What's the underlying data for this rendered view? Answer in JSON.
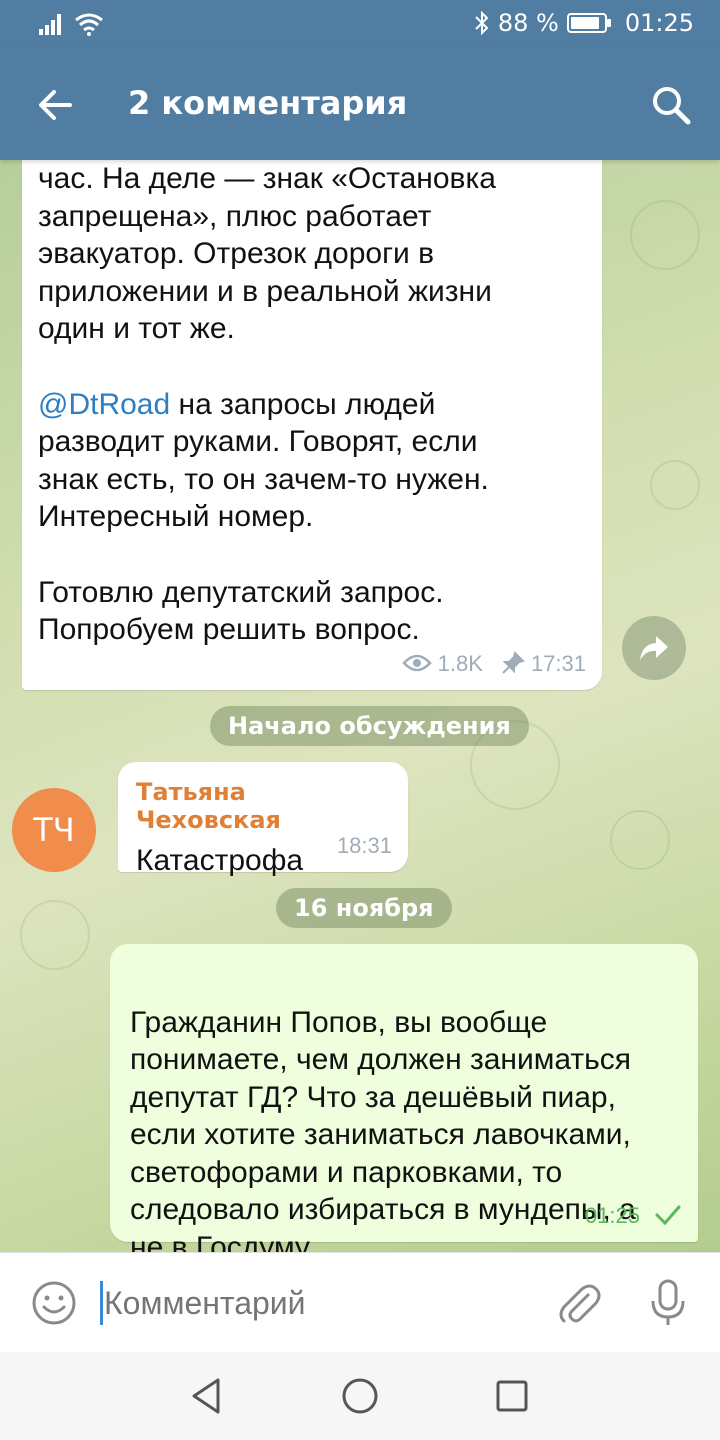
{
  "status_bar": {
    "battery_percent": "88 %",
    "battery_level": 0.88,
    "time": "01:25"
  },
  "header": {
    "title": "2 комментария"
  },
  "post": {
    "lines_1": "час. На деле — знак «Остановка\nзапрещена», плюс работает\nэвакуатор. Отрезок дороги в\nприложении и в реальной жизни\nодин и тот же.",
    "mention": "@DtRoad",
    "lines_2_head": " на запросы людей",
    "lines_2_tail": "разводит руками. Говорят, если\nзнак есть, то он зачем-то нужен.\nИнтересный номер.",
    "lines_3": "Готовлю депутатский запрос.\nПопробуем решить вопрос.",
    "views": "1.8K",
    "time": "17:31"
  },
  "separators": {
    "discussion_start": "Начало обсуждения",
    "date": "16 ноября"
  },
  "incoming_message": {
    "avatar_initials": "ТЧ",
    "author": "Татьяна Чеховская",
    "text": "Катастрофа",
    "time": "18:31"
  },
  "outgoing_message": {
    "text": "Гражданин Попов, вы вообще\nпонимаете, чем должен заниматься\nдепутат ГД? Что за дешёвый пиар,\nесли хотите заниматься лавочками,\nсветофорами и парковками, то\nследовало избираться в мундепы, а\nне в Госдуму.",
    "time": "01:25"
  },
  "input": {
    "placeholder": "Комментарий"
  },
  "colors": {
    "header_bg": "#517da2",
    "mention": "#2e7fc2",
    "author": "#e07f36",
    "avatar": "#f08c4c",
    "outgoing_bg": "#effedd",
    "check": "#5cb85c"
  }
}
